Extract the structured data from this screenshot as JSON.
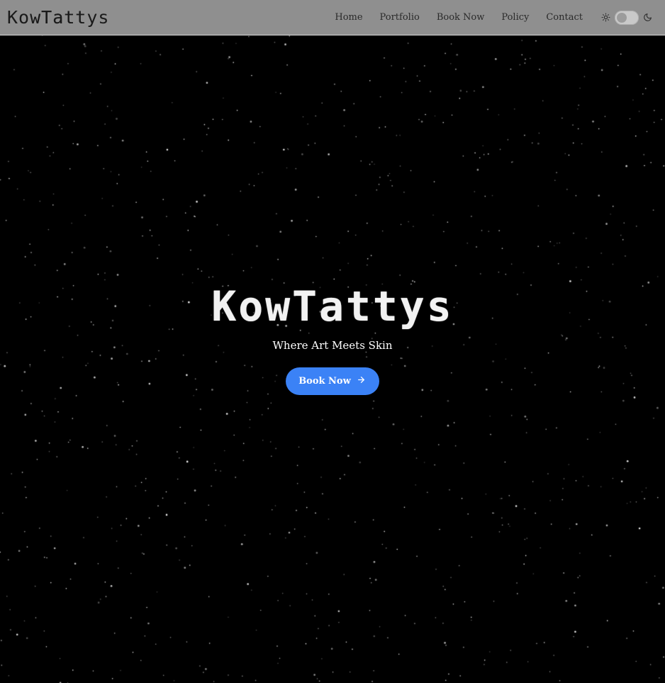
{
  "nav": {
    "brand": "KowTattys",
    "links": [
      "Home",
      "Portfolio",
      "Book Now",
      "Policy",
      "Contact"
    ],
    "theme_toggle": {
      "light_icon": "sun-icon",
      "dark_icon": "moon-icon",
      "state": "off"
    }
  },
  "hero": {
    "title": "KowTattys",
    "tagline": "Where Art Meets Skin",
    "cta_label": "Book Now",
    "cta_icon": "arrow-right-icon"
  },
  "colors": {
    "background": "#000000",
    "navbar": "#8f8f8f",
    "accent": "#3b82f6",
    "stars": "#ffffff"
  }
}
